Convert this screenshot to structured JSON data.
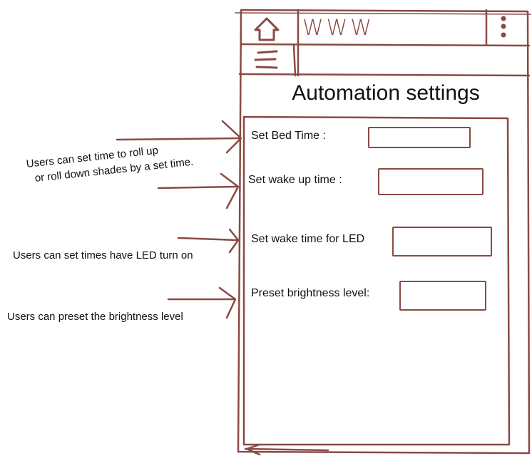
{
  "browser": {
    "url_text": "WWW"
  },
  "page": {
    "title": "Automation settings"
  },
  "form": {
    "bed_time_label": "Set Bed Time :",
    "wake_up_time_label": "Set wake up time :",
    "led_wake_time_label": "Set wake time for LED",
    "brightness_label": "Preset brightness level:"
  },
  "annotations": {
    "shades_line1": "Users can set time to roll up",
    "shades_line2": "or roll down shades by a set time.",
    "led": "Users can set times have LED turn on",
    "brightness": "Users can preset the brightness level"
  },
  "colors": {
    "ink": "#8a4a44",
    "text": "#111111",
    "background": "#ffffff"
  },
  "icons": {
    "home": "home-icon",
    "menu": "menu-icon",
    "more": "more-vertical-icon"
  }
}
